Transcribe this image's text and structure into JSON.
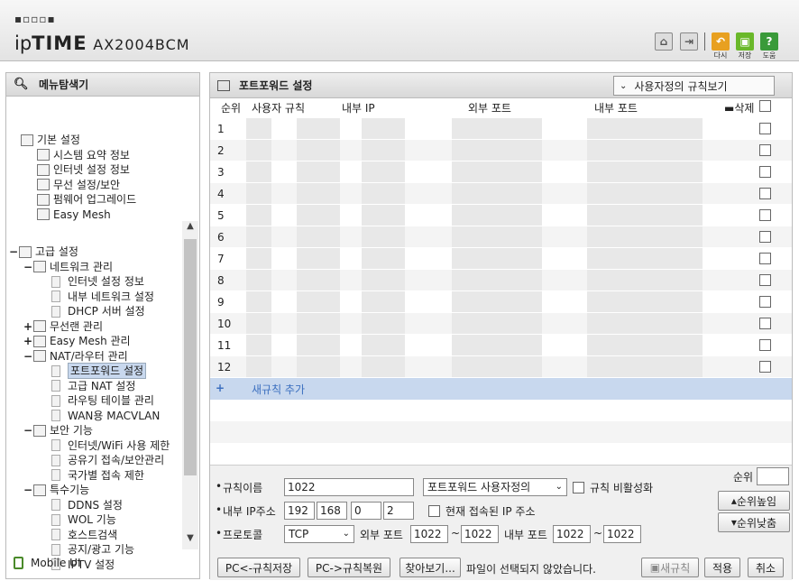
{
  "header": {
    "logo_dots": "▪▫▫▫▪",
    "brand_ip": "ip",
    "brand_time": "TIME",
    "model": "AX2004BCM",
    "actions": [
      {
        "label": "다시",
        "color": "#e8a020"
      },
      {
        "label": "저장",
        "color": "#6ab82a"
      },
      {
        "label": "도움",
        "color": "#3a9a3a"
      }
    ]
  },
  "nav": {
    "title": "메뉴탐색기",
    "basic": {
      "label": "기본 설정",
      "items": [
        "시스템 요약 정보",
        "인터넷 설정 정보",
        "무선 설정/보안",
        "펌웨어 업그레이드",
        "Easy Mesh"
      ]
    },
    "advanced": {
      "label": "고급 설정",
      "groups": [
        {
          "label": "네트워크 관리",
          "pm": "−",
          "items": [
            "인터넷 설정 정보",
            "내부 네트워크 설정",
            "DHCP 서버 설정"
          ]
        },
        {
          "label": "무선랜 관리",
          "pm": "+",
          "items": []
        },
        {
          "label": "Easy Mesh 관리",
          "pm": "+",
          "items": []
        },
        {
          "label": "NAT/라우터 관리",
          "pm": "−",
          "items": [
            "포트포워드 설정",
            "고급 NAT 설정",
            "라우팅 테이블 관리",
            "WAN용 MACVLAN"
          ]
        },
        {
          "label": "보안 기능",
          "pm": "−",
          "items": [
            "인터넷/WiFi 사용 제한",
            "공유기 접속/보안관리",
            "국가별 접속 제한"
          ]
        },
        {
          "label": "특수기능",
          "pm": "−",
          "items": [
            "DDNS 설정",
            "WOL 기능",
            "호스트검색",
            "공지/광고 기능",
            "IPTV 설정"
          ]
        }
      ]
    },
    "mobile": "Mobile UI"
  },
  "main": {
    "title": "포트포워드 설정",
    "view_select": "사용자정의 규칙보기",
    "columns": [
      "순위",
      "사용자 규칙",
      "내부 IP",
      "외부 포트",
      "내부 포트",
      "삭제"
    ],
    "rows": [
      "1",
      "2",
      "3",
      "4",
      "5",
      "6",
      "7",
      "8",
      "9",
      "10",
      "11",
      "12"
    ],
    "add_rule": "새규칙 추가",
    "form": {
      "rule_name_label": "규칙이름",
      "rule_name": "1022",
      "rule_type": "포트포워드 사용자정의",
      "disable_label": "규칙 비활성화",
      "ip_label": "내부 IP주소",
      "ip": [
        "192",
        "168",
        "0",
        "2"
      ],
      "current_ip_label": "현재 접속된 IP 주소",
      "proto_label": "프로토콜",
      "protocol": "TCP",
      "ext_port_label": "외부 포트",
      "ext_from": "1022",
      "ext_to": "1022",
      "int_port_label": "내부 포트",
      "int_from": "1022",
      "int_to": "1022",
      "tilde": "~",
      "bullet": "•",
      "order_label": "순위",
      "order_up": "순위높임",
      "order_down": "순위낮춤"
    },
    "buttons": {
      "save_pc": "PC<-규칙저장",
      "restore_pc": "PC->규칙복원",
      "browse": "찾아보기...",
      "no_file": "파일이 선택되지 않았습니다.",
      "new_rule": "새규칙",
      "apply": "적용",
      "cancel": "취소"
    }
  }
}
